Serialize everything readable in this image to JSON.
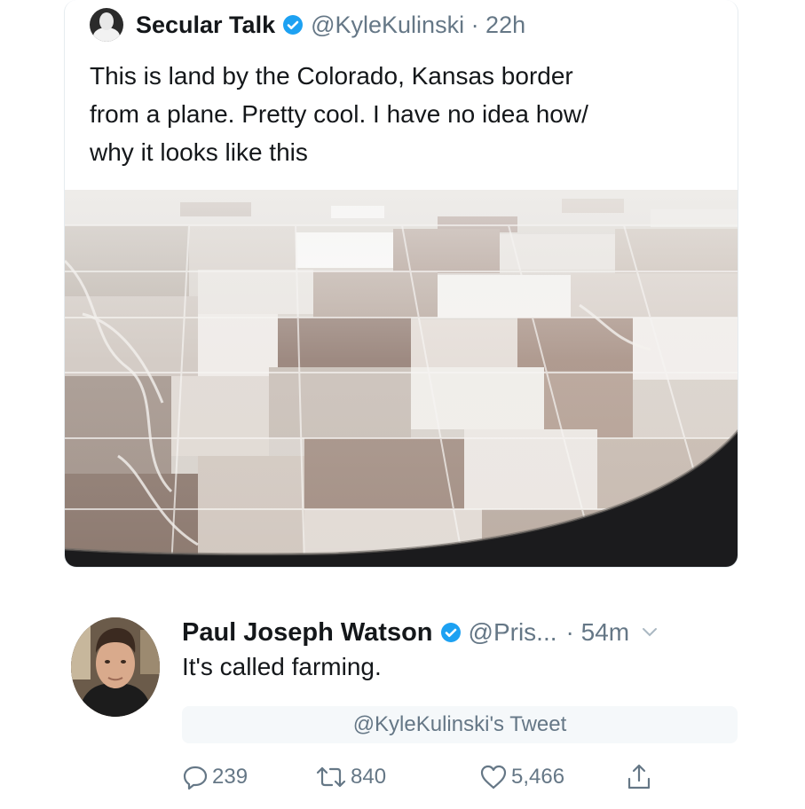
{
  "quoted_tweet": {
    "name": "Secular Talk",
    "handle_time": "@KyleKulinski · 22h",
    "text_lines": [
      "This is land by the Colorado, Kansas border",
      "from a plane. Pretty cool. I have no idea how/",
      "why it looks like this"
    ]
  },
  "reply": {
    "name": "Paul Joseph Watson",
    "handle": "@Pris...",
    "time": "· 54m",
    "text": "It's called farming.",
    "quote_reference": "@KyleKulinski's Tweet"
  },
  "actions": {
    "replies": "239",
    "retweets": "840",
    "likes": "5,466"
  },
  "colors": {
    "verified_blue": "#1da1f2",
    "secondary_text": "#657786",
    "primary_text": "#14171a"
  }
}
